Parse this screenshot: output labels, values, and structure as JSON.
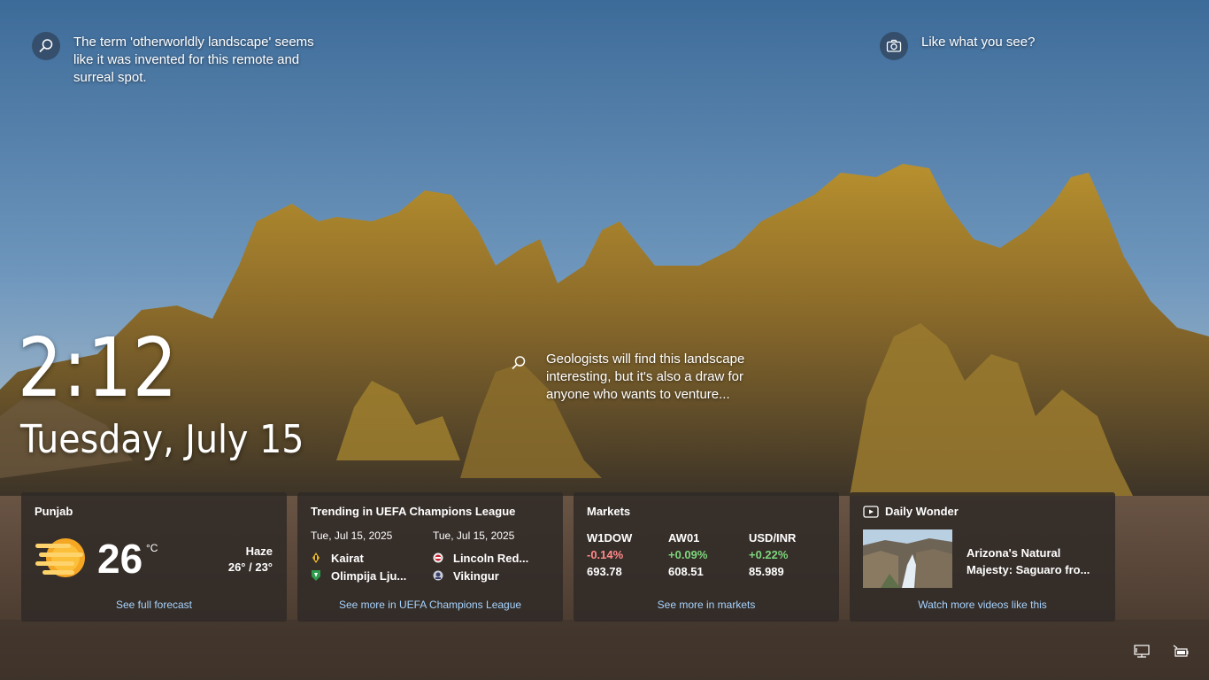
{
  "spotlight": {
    "top_fact": "The term 'otherworldly landscape' seems like it was invented for this remote and surreal spot.",
    "like_prompt": "Like what you see?",
    "middle_fact": "Geologists will find this landscape interesting, but it's also a draw for anyone who wants to venture..."
  },
  "clock": {
    "time": "2:12",
    "date": "Tuesday, July 15"
  },
  "weather": {
    "location": "Punjab",
    "temperature": "26",
    "unit": "°C",
    "condition": "Haze",
    "range": "26° / 23°",
    "link": "See full forecast"
  },
  "sports": {
    "title": "Trending in UEFA Champions League",
    "matches": [
      {
        "date": "Tue, Jul 15, 2025",
        "team1": "Kairat",
        "team2": "Olimpija Lju..."
      },
      {
        "date": "Tue, Jul 15, 2025",
        "team1": "Lincoln Red...",
        "team2": "Vikingur"
      }
    ],
    "link": "See more in UEFA Champions League"
  },
  "markets": {
    "title": "Markets",
    "stocks": [
      {
        "symbol": "W1DOW",
        "change": "-0.14%",
        "value": "693.78"
      },
      {
        "symbol": "AW01",
        "change": "+0.09%",
        "value": "608.51"
      },
      {
        "symbol": "USD/INR",
        "change": "+0.22%",
        "value": "85.989"
      }
    ],
    "link": "See more in markets"
  },
  "daily_wonder": {
    "title": "Daily Wonder",
    "caption": "Arizona's Natural Majesty: Saguaro fro...",
    "link": "Watch more videos like this"
  },
  "colors": {
    "link": "#a8d4ff",
    "negative": "#ff8a8a",
    "positive": "#7ed67e",
    "card_bg": "#302a26"
  },
  "icons": {
    "spotlight": "search-icon",
    "like": "camera-icon",
    "tray_network": "network-icon",
    "tray_battery": "battery-icon"
  }
}
